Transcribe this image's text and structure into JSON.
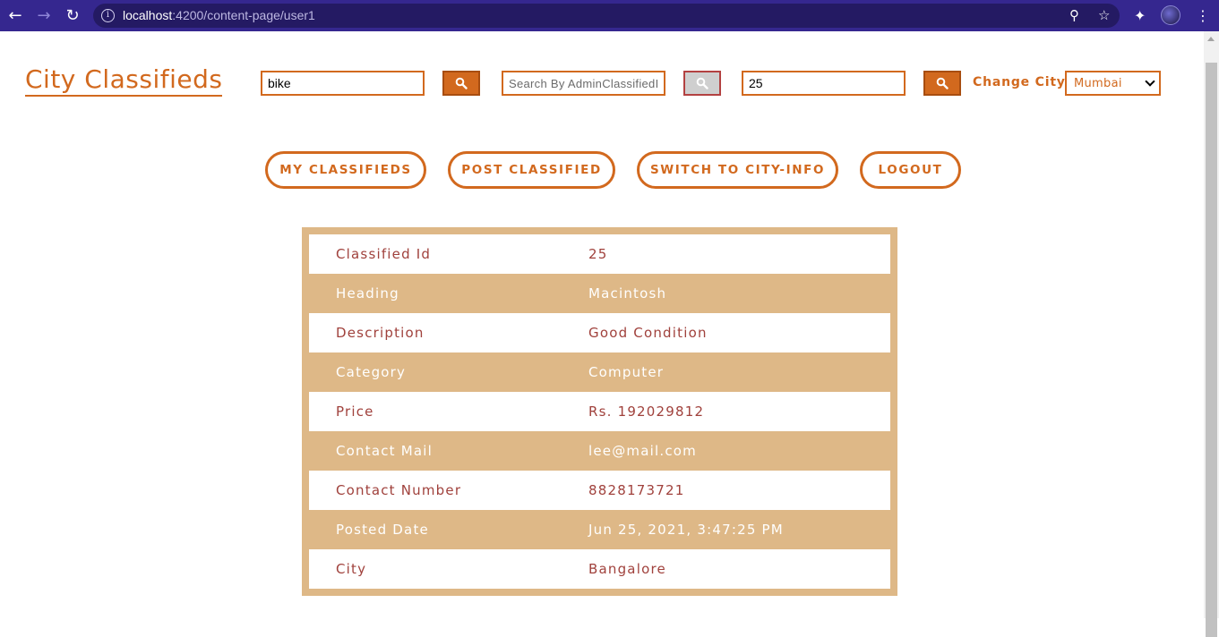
{
  "browser": {
    "url_host": "localhost",
    "url_path": ":4200/content-page/user1"
  },
  "header": {
    "brand": "City Classifieds",
    "search1_value": "bike",
    "search2_placeholder": "Search By AdminClassifiedId",
    "search3_value": "25",
    "change_city_label": "Change City",
    "city_selected": "Mumbai"
  },
  "nav": {
    "my_classifieds": "MY CLASSIFIEDS",
    "post_classified": "POST CLASSIFIED",
    "switch_city_info": "SWITCH TO CITY-INFO",
    "logout": "LOGOUT"
  },
  "details": [
    {
      "label": "Classified Id",
      "value": "25"
    },
    {
      "label": "Heading",
      "value": "Macintosh"
    },
    {
      "label": "Description",
      "value": "Good Condition"
    },
    {
      "label": "Category",
      "value": "Computer"
    },
    {
      "label": "Price",
      "value": "Rs. 192029812"
    },
    {
      "label": "Contact Mail",
      "value": "lee@mail.com"
    },
    {
      "label": "Contact Number",
      "value": "8828173721"
    },
    {
      "label": "Posted Date",
      "value": "Jun 25, 2021, 3:47:25 PM"
    },
    {
      "label": "City",
      "value": "Bangalore"
    }
  ],
  "colors": {
    "accent": "#d2691e",
    "table_bg": "#deb887",
    "row_text": "#a0413c",
    "chrome": "#35278f"
  }
}
